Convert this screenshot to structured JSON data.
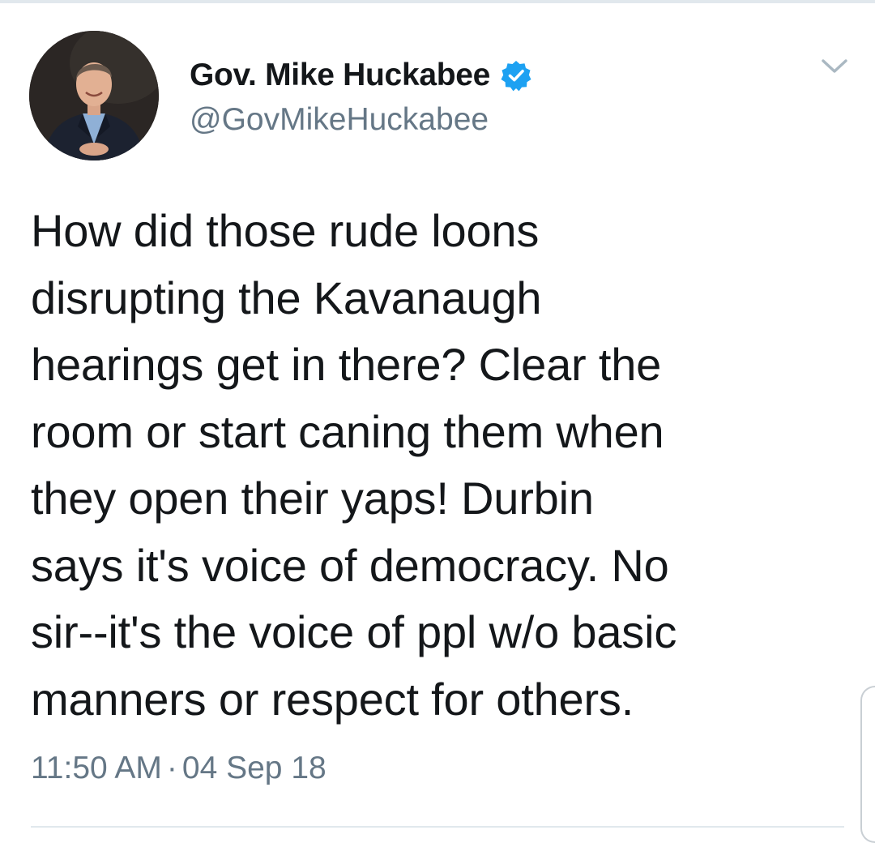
{
  "tweet": {
    "author": {
      "display_name": "Gov. Mike Huckabee",
      "handle": "@GovMikeHuckabee",
      "verified": true,
      "avatar_icon": "profile-photo"
    },
    "text": "How did those rude loons\ndisrupting the Kavanaugh\nhearings get in there?  Clear the\nroom or start caning them when\nthey open their yaps!  Durbin\nsays it's voice of democracy. No\nsir--it's the voice of ppl w/o basic\nmanners or respect for others.",
    "time": "11:50 AM",
    "separator": "·",
    "date": "04 Sep 18"
  },
  "icons": {
    "verified": "verified-badge-icon",
    "menu": "chevron-down-icon"
  },
  "colors": {
    "text": "#14171a",
    "secondary": "#657786",
    "verified_blue": "#1da1f2",
    "divider": "#e1e8ed"
  }
}
